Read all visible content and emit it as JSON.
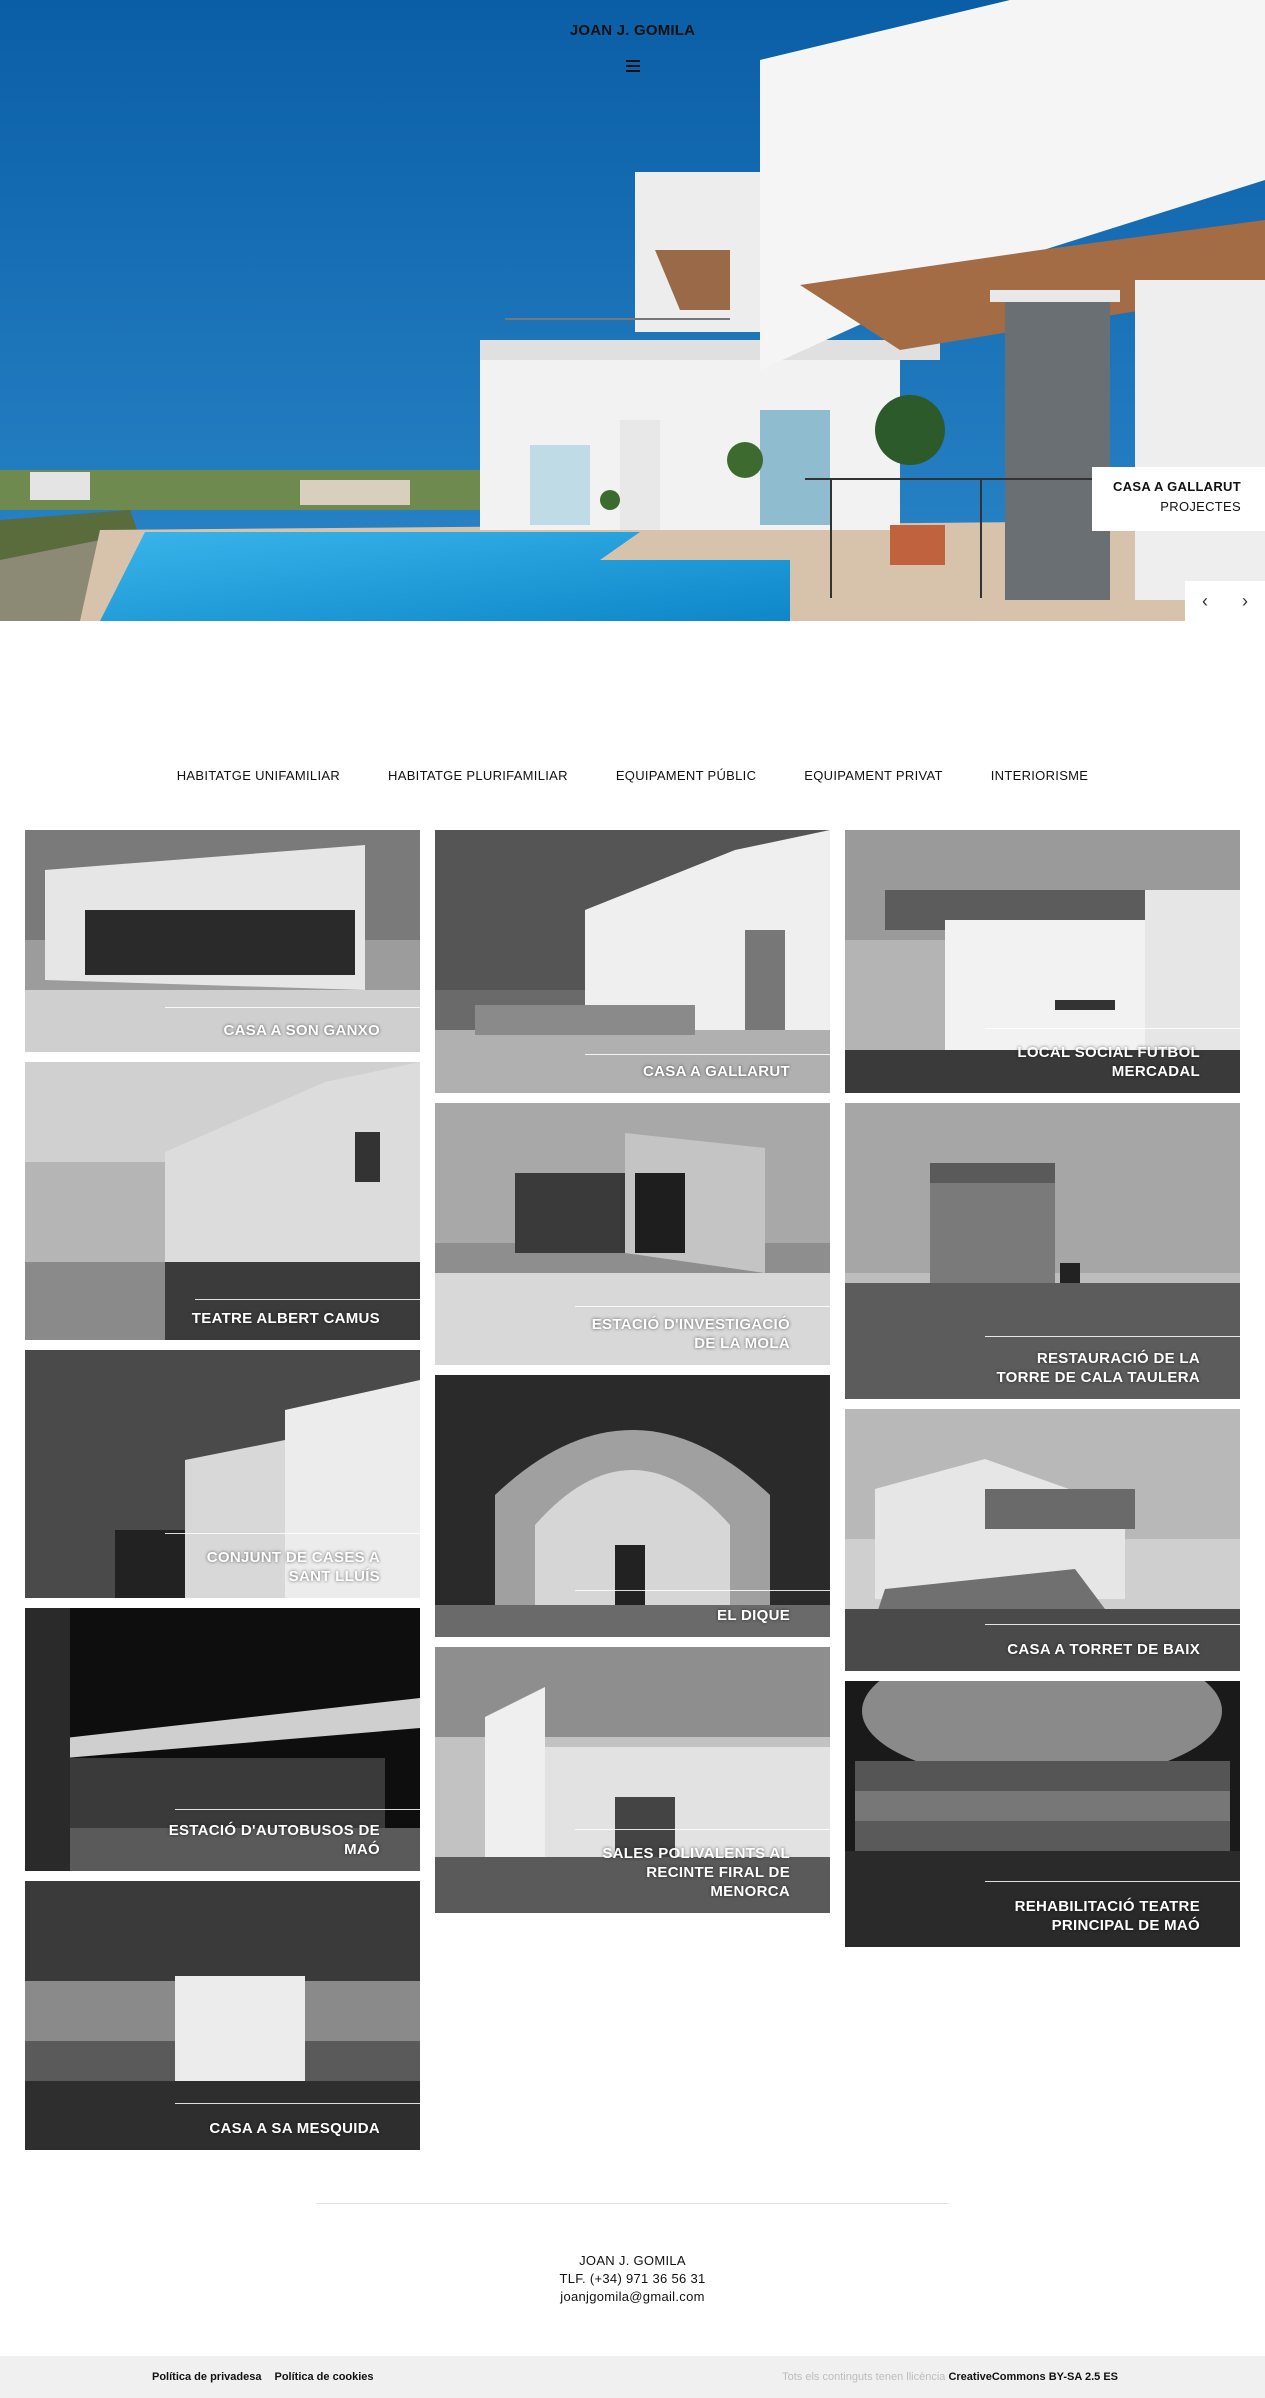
{
  "header": {
    "brand": "JOAN J. GOMILA",
    "menu_icon": "hamburger-icon"
  },
  "hero": {
    "caption_title": "CASA A GALLARUT",
    "caption_subtitle": "PROJECTES",
    "prev_icon": "‹",
    "next_icon": "›"
  },
  "filters": [
    "HABITATGE UNIFAMILIAR",
    "HABITATGE PLURIFAMILIAR",
    "EQUIPAMENT PÚBLIC",
    "EQUIPAMENT PRIVAT",
    "INTERIORISME"
  ],
  "projects": {
    "p1": "CASA A SON GANXO",
    "p2": "TEATRE ALBERT CAMUS",
    "p3_line1": "CONJUNT DE CASES A",
    "p3_line2": "SANT LLUÍS",
    "p4_line1": "ESTACIÓ D'AUTOBUSOS DE",
    "p4_line2": "MAÓ",
    "p5": "CASA A SA MESQUIDA",
    "p6": "CASA A GALLARUT",
    "p7_line1": "ESTACIÓ D'INVESTIGACIÓ",
    "p7_line2": "DE LA MOLA",
    "p8": "EL DIQUE",
    "p9_line1": "SALES POLIVALENTS AL",
    "p9_line2": "RECINTE FIRAL DE",
    "p9_line3": "MENORCA",
    "p10_line1": "LOCAL SOCIAL FUTBOL",
    "p10_line2": "MERCADAL",
    "p11_line1": "RESTAURACIÓ DE LA",
    "p11_line2": "TORRE DE CALA TAULERA",
    "p12": "CASA A TORRET DE BAIX",
    "p13_line1": "REHABILITACIÓ TEATRE",
    "p13_line2": "PRINCIPAL DE MAÓ"
  },
  "footer": {
    "name": "JOAN J. GOMILA",
    "phone": "TLF. (+34) 971 36 56 31",
    "email": "joanjgomila@gmail.com",
    "privacy": "Política de privadesa",
    "cookies": "Política de cookies",
    "license_text": "Tots els continguts tenen llicència",
    "license_name": "CreativeCommons BY-SA 2.5 ES"
  },
  "colors": {
    "sky": "#0b62a8",
    "pool": "#29a6e0",
    "footer_bar": "#f0f0f0"
  }
}
